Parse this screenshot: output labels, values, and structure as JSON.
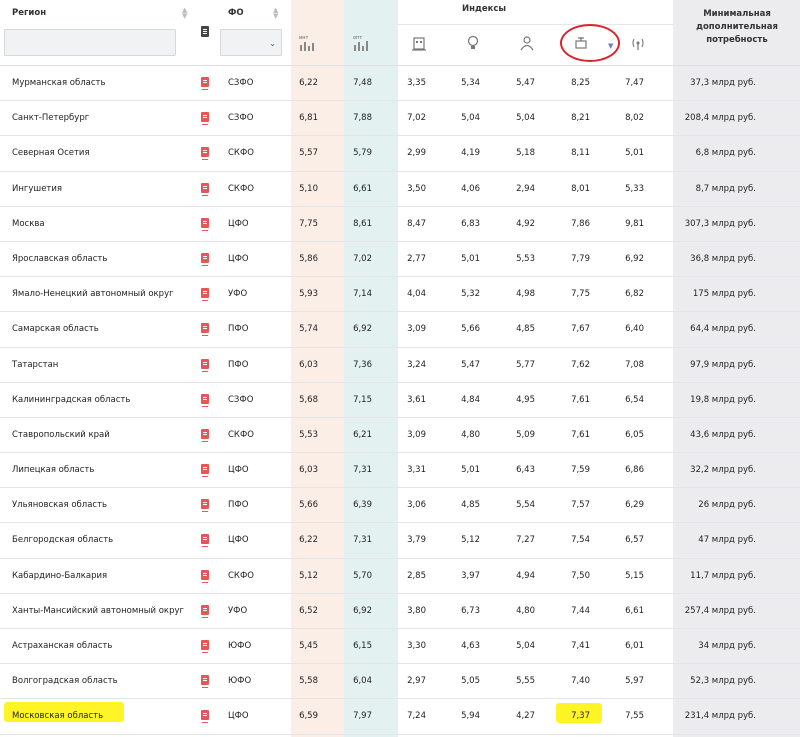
{
  "header": {
    "region_label": "Регион",
    "fo_label": "ФО",
    "indexes_label": "Индексы",
    "need_label_1": "Минимальная",
    "need_label_2": "дополнительная",
    "need_label_3": "потребность",
    "int_icon_text": "инт",
    "opt_icon_text": "опт",
    "region_filter_value": "",
    "fo_select_value": ""
  },
  "icons": [
    "int-chart-icon",
    "opt-chart-icon",
    "building-icon",
    "bulb-icon",
    "people-icon",
    "stethoscope-icon",
    "antenna-icon",
    "document-icon"
  ],
  "colors": {
    "int_col": "#fbeee6",
    "opt_col": "#e3f1f1",
    "need_col": "#ececef",
    "doc_icon": "#e5565a",
    "highlight": "#fff200",
    "circle": "#d8252a"
  },
  "rows": [
    {
      "region": "Мурманская область",
      "fo": "СЗФО",
      "int": "6,22",
      "opt": "7,48",
      "i1": "3,35",
      "i2": "5,34",
      "i3": "5,47",
      "i4": "8,25",
      "i5": "7,47",
      "need": "37,3 млрд руб."
    },
    {
      "region": "Санкт-Петербург",
      "fo": "СЗФО",
      "int": "6,81",
      "opt": "7,88",
      "i1": "7,02",
      "i2": "5,04",
      "i3": "5,04",
      "i4": "8,21",
      "i5": "8,02",
      "need": "208,4 млрд руб."
    },
    {
      "region": "Северная Осетия",
      "fo": "СКФО",
      "int": "5,57",
      "opt": "5,79",
      "i1": "2,99",
      "i2": "4,19",
      "i3": "5,18",
      "i4": "8,11",
      "i5": "5,01",
      "need": "6,8 млрд руб."
    },
    {
      "region": "Ингушетия",
      "fo": "СКФО",
      "int": "5,10",
      "opt": "6,61",
      "i1": "3,50",
      "i2": "4,06",
      "i3": "2,94",
      "i4": "8,01",
      "i5": "5,33",
      "need": "8,7 млрд руб."
    },
    {
      "region": "Москва",
      "fo": "ЦФО",
      "int": "7,75",
      "opt": "8,61",
      "i1": "8,47",
      "i2": "6,83",
      "i3": "4,92",
      "i4": "7,86",
      "i5": "9,81",
      "need": "307,3 млрд руб."
    },
    {
      "region": "Ярославская область",
      "fo": "ЦФО",
      "int": "5,86",
      "opt": "7,02",
      "i1": "2,77",
      "i2": "5,01",
      "i3": "5,53",
      "i4": "7,79",
      "i5": "6,92",
      "need": "36,8 млрд руб."
    },
    {
      "region": "Ямало-Ненецкий автономный округ",
      "fo": "УФО",
      "int": "5,93",
      "opt": "7,14",
      "i1": "4,04",
      "i2": "5,32",
      "i3": "4,98",
      "i4": "7,75",
      "i5": "6,82",
      "need": "175 млрд руб."
    },
    {
      "region": "Самарская область",
      "fo": "ПФО",
      "int": "5,74",
      "opt": "6,92",
      "i1": "3,09",
      "i2": "5,66",
      "i3": "4,85",
      "i4": "7,67",
      "i5": "6,40",
      "need": "64,4 млрд руб."
    },
    {
      "region": "Татарстан",
      "fo": "ПФО",
      "int": "6,03",
      "opt": "7,36",
      "i1": "3,24",
      "i2": "5,47",
      "i3": "5,77",
      "i4": "7,62",
      "i5": "7,08",
      "need": "97,9 млрд руб."
    },
    {
      "region": "Калининградская область",
      "fo": "СЗФО",
      "int": "5,68",
      "opt": "7,15",
      "i1": "3,61",
      "i2": "4,84",
      "i3": "4,95",
      "i4": "7,61",
      "i5": "6,54",
      "need": "19,8 млрд руб."
    },
    {
      "region": "Ставропольский край",
      "fo": "СКФО",
      "int": "5,53",
      "opt": "6,21",
      "i1": "3,09",
      "i2": "4,80",
      "i3": "5,09",
      "i4": "7,61",
      "i5": "6,05",
      "need": "43,6 млрд руб."
    },
    {
      "region": "Липецкая область",
      "fo": "ЦФО",
      "int": "6,03",
      "opt": "7,31",
      "i1": "3,31",
      "i2": "5,01",
      "i3": "6,43",
      "i4": "7,59",
      "i5": "6,86",
      "need": "32,2 млрд руб."
    },
    {
      "region": "Ульяновская область",
      "fo": "ПФО",
      "int": "5,66",
      "opt": "6,39",
      "i1": "3,06",
      "i2": "4,85",
      "i3": "5,54",
      "i4": "7,57",
      "i5": "6,29",
      "need": "26 млрд руб."
    },
    {
      "region": "Белгородская область",
      "fo": "ЦФО",
      "int": "6,22",
      "opt": "7,31",
      "i1": "3,79",
      "i2": "5,12",
      "i3": "7,27",
      "i4": "7,54",
      "i5": "6,57",
      "need": "47 млрд руб."
    },
    {
      "region": "Кабардино-Балкария",
      "fo": "СКФО",
      "int": "5,12",
      "opt": "5,70",
      "i1": "2,85",
      "i2": "3,97",
      "i3": "4,94",
      "i4": "7,50",
      "i5": "5,15",
      "need": "11,7 млрд руб."
    },
    {
      "region": "Ханты-Мансийский автономный округ",
      "fo": "УФО",
      "int": "6,52",
      "opt": "6,92",
      "i1": "3,80",
      "i2": "6,73",
      "i3": "4,80",
      "i4": "7,44",
      "i5": "6,61",
      "need": "257,4 млрд руб."
    },
    {
      "region": "Астраханская область",
      "fo": "ЮФО",
      "int": "5,45",
      "opt": "6,15",
      "i1": "3,30",
      "i2": "4,63",
      "i3": "5,04",
      "i4": "7,41",
      "i5": "6,01",
      "need": "34 млрд руб."
    },
    {
      "region": "Волгоградская область",
      "fo": "ЮФО",
      "int": "5,58",
      "opt": "6,04",
      "i1": "2,97",
      "i2": "5,05",
      "i3": "5,55",
      "i4": "7,40",
      "i5": "5,97",
      "need": "52,3 млрд руб."
    },
    {
      "region": "Московская область",
      "fo": "ЦФО",
      "int": "6,59",
      "opt": "7,97",
      "i1": "7,24",
      "i2": "5,94",
      "i3": "4,27",
      "i4": "7,37",
      "i5": "7,55",
      "need": "231,4 млрд руб."
    }
  ]
}
